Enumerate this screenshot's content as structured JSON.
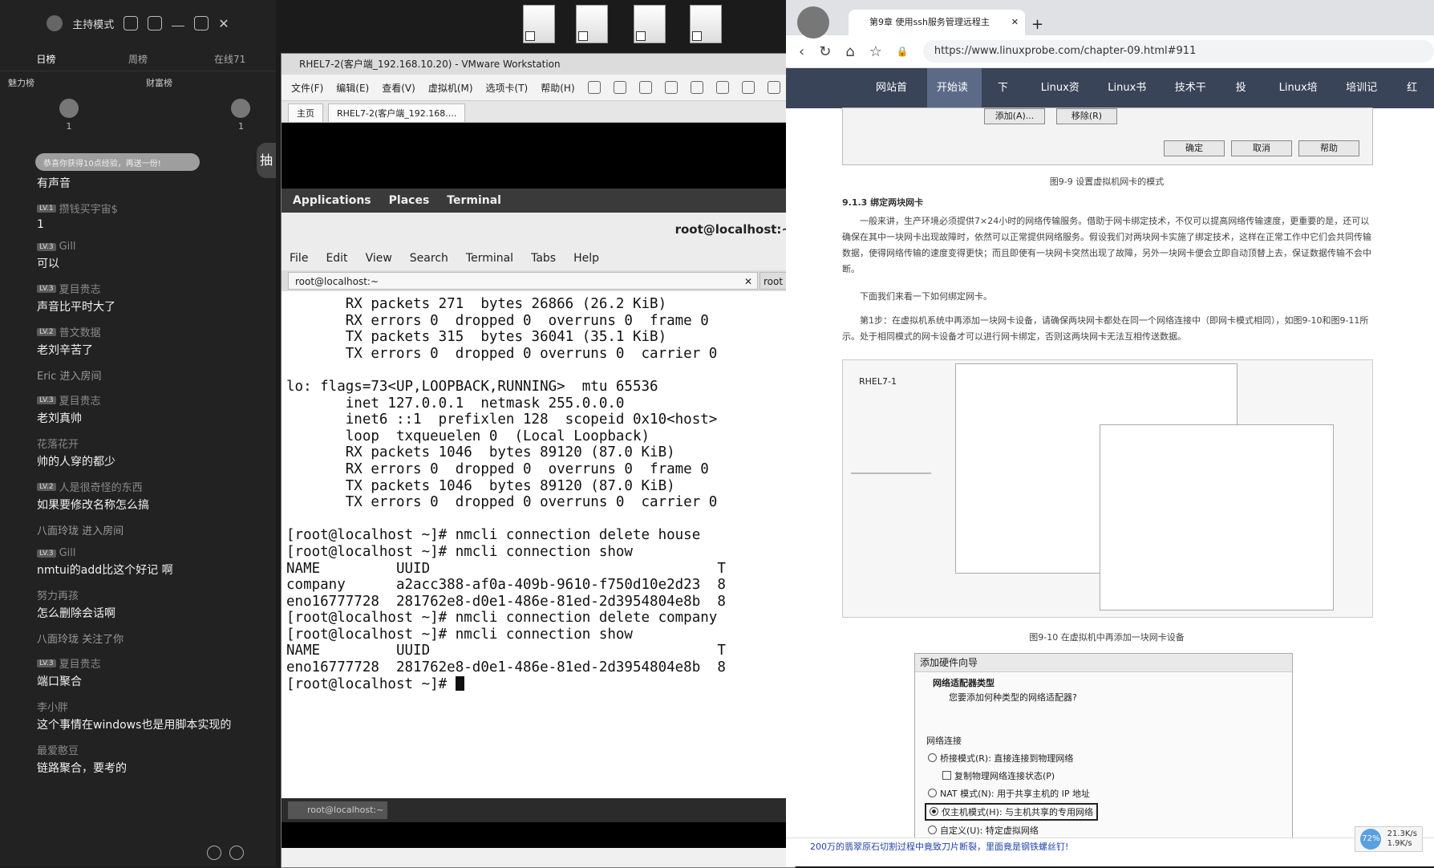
{
  "chat": {
    "title": "主持模式",
    "tabs": [
      "日榜",
      "周榜",
      "在线71"
    ],
    "ranks": [
      {
        "label": "魅力榜",
        "count": "1"
      },
      {
        "label": "财富榜",
        "count": "1"
      }
    ],
    "gift_notice": "恭喜你获得10点经验，再送一份!",
    "side_badge": "抽",
    "messages": [
      {
        "user": "",
        "level": "",
        "text": "有声音"
      },
      {
        "user": "攒钱买宇宙$",
        "level": "LV.1",
        "text": "1"
      },
      {
        "user": "Gill",
        "level": "LV.3",
        "text": "可以"
      },
      {
        "user": "夏目贵志",
        "level": "LV.3",
        "text": "声音比平时大了"
      },
      {
        "user": "普文数据",
        "level": "LV.2",
        "text": "老刘辛苦了"
      },
      {
        "system": "Eric 进入房间"
      },
      {
        "user": "夏目贵志",
        "level": "LV.3",
        "text": "老刘真帅"
      },
      {
        "user": "花落花开",
        "level": "",
        "text": "帅的人穿的都少"
      },
      {
        "user": "人是很奇怪的东西",
        "level": "LV.2",
        "text": "如果要修改名称怎么搞"
      },
      {
        "system": "八面玲珑 进入房间"
      },
      {
        "user": "Gill",
        "level": "LV.3",
        "text": "nmtui的add比这个好记 啊"
      },
      {
        "user": "努力再孩",
        "level": "",
        "text": "怎么删除会话啊"
      },
      {
        "system": "八面玲珑 关注了你"
      },
      {
        "user": "夏目贵志",
        "level": "LV.3",
        "text": "端口聚合"
      },
      {
        "user": "李小胖",
        "level": "",
        "text": "这个事情在windows也是用脚本实现的"
      },
      {
        "user": "最爱憨豆",
        "level": "",
        "text": "链路聚合，要考的"
      }
    ]
  },
  "vmware": {
    "title": "RHEL7-2(客户端_192.168.10.20) - VMware Workstation",
    "menu": [
      "文件(F)",
      "编辑(E)",
      "查看(V)",
      "虚拟机(M)",
      "选项卡(T)",
      "帮助(H)"
    ],
    "tabs": [
      "主页",
      "RHEL7-2(客户端_192.168...."
    ],
    "gnome": {
      "applications": "Applications",
      "places": "Places",
      "terminal": "Terminal"
    },
    "terminal_title": "root@localhost:~",
    "terminal_menu": [
      "File",
      "Edit",
      "View",
      "Search",
      "Terminal",
      "Tabs",
      "Help"
    ],
    "terminal_tab1": "root@localhost:~",
    "terminal_tab2": "root",
    "terminal_lines": [
      "       RX packets 271  bytes 26866 (26.2 KiB)",
      "       RX errors 0  dropped 0  overruns 0  frame 0",
      "       TX packets 315  bytes 36041 (35.1 KiB)",
      "       TX errors 0  dropped 0 overruns 0  carrier 0",
      "",
      "lo: flags=73<UP,LOOPBACK,RUNNING>  mtu 65536",
      "       inet 127.0.0.1  netmask 255.0.0.0",
      "       inet6 ::1  prefixlen 128  scopeid 0x10<host>",
      "       loop  txqueuelen 0  (Local Loopback)",
      "       RX packets 1046  bytes 89120 (87.0 KiB)",
      "       RX errors 0  dropped 0  overruns 0  frame 0",
      "       TX packets 1046  bytes 89120 (87.0 KiB)",
      "       TX errors 0  dropped 0 overruns 0  carrier 0",
      "",
      "[root@localhost ~]# nmcli connection delete house",
      "[root@localhost ~]# nmcli connection show",
      "NAME         UUID                                  T",
      "company      a2acc388-af0a-409b-9610-f750d10e2d23  8",
      "eno16777728  281762e8-d0e1-486e-81ed-2d3954804e8b  8",
      "[root@localhost ~]# nmcli connection delete company",
      "[root@localhost ~]# nmcli connection show",
      "NAME         UUID                                  T",
      "eno16777728  281762e8-d0e1-486e-81ed-2d3954804e8b  8"
    ],
    "prompt": "[root@localhost ~]# ",
    "taskbar_item": "root@localhost:~"
  },
  "browser": {
    "tab_title": "第9章 使用ssh服务管理远程主",
    "url": "https://www.linuxprobe.com/chapter-09.html#911",
    "nav": [
      "网站首页",
      "开始读书",
      "下载",
      "Linux资讯",
      "Linux书籍",
      "技术干货",
      "投稿",
      "Linux培训",
      "培训记录",
      "红帽"
    ],
    "dialog_buttons": {
      "add": "添加(A)...",
      "remove": "移除(R)",
      "ok": "确定",
      "cancel": "取消",
      "help": "帮助"
    },
    "fig9_9_caption": "图9-9  设置虚拟机网卡的模式",
    "section": "9.1.3 绑定两块网卡",
    "para1": "一般来讲，生产环境必须提供7×24小时的网络传输服务。借助于网卡绑定技术，不仅可以提高网络传输速度，更重要的是，还可以确保在其中一块网卡出现故障时，依然可以正常提供网络服务。假设我们对两块网卡实施了绑定技术，这样在正常工作中它们会共同传输数据，使得网络传输的速度变得更快；而且即使有一块网卡突然出现了故障，另外一块网卡便会立即自动顶替上去，保证数据传输不会中断。",
    "para2": "下面我们来看一下如何绑定网卡。",
    "para3": "第1步：在虚拟机系统中再添加一块网卡设备，请确保两块网卡都处在同一个网络连接中（即网卡模式相同），如图9-10和图9-11所示。处于相同模式的网卡设备才可以进行网卡绑定，否则这两块网卡无法互相传送数据。",
    "fig_vm_name": "RHEL7-1",
    "fig9_10_caption": "图9-10  在虚拟机中再添加一块网卡设备",
    "wizard": {
      "title": "添加硬件向导",
      "heading": "网络适配器类型",
      "question": "您要添加何种类型的网络适配器?",
      "group": "网络连接",
      "opt1": "桥接模式(R): 直接连接到物理网络",
      "opt1_sub": "复制物理网络连接状态(P)",
      "opt2": "NAT 模式(N): 用于共享主机的 IP 地址",
      "opt3": "仅主机模式(H): 与主机共享的专用网络",
      "opt4": "自定义(U): 特定虚拟网络"
    },
    "status_text": "200万的翡翠原石切割过程中竟致刀片断裂，里面竟是钢铁螺丝钉!",
    "netmon": {
      "pct": "72%",
      "up": "21.3K/s",
      "down": "1.9K/s"
    }
  }
}
